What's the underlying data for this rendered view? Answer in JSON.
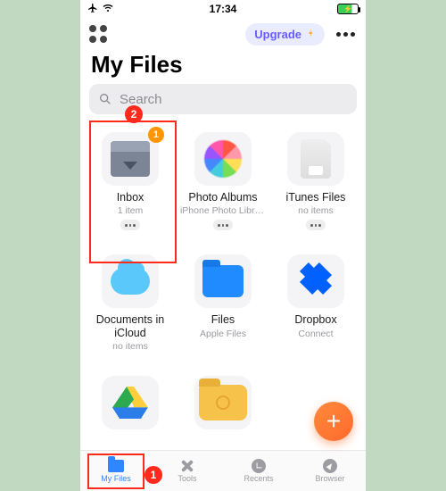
{
  "statusbar": {
    "time": "17:34"
  },
  "header": {
    "upgrade_label": "Upgrade",
    "title": "My Files"
  },
  "search": {
    "placeholder": "Search"
  },
  "tiles": [
    {
      "label": "Inbox",
      "sub": "1 item",
      "icon": "inbox",
      "badge": "1",
      "has_more": true
    },
    {
      "label": "Photo Albums",
      "sub": "iPhone Photo Libra...",
      "icon": "photos",
      "badge": null,
      "has_more": true
    },
    {
      "label": "iTunes Files",
      "sub": "no items",
      "icon": "itunes",
      "badge": null,
      "has_more": true
    },
    {
      "label": "Documents in iCloud",
      "sub": "no items",
      "icon": "icloud",
      "badge": null,
      "has_more": false
    },
    {
      "label": "Files",
      "sub": "Apple Files",
      "icon": "files",
      "badge": null,
      "has_more": false
    },
    {
      "label": "Dropbox",
      "sub": "Connect",
      "icon": "dropbox",
      "badge": null,
      "has_more": false
    },
    {
      "label": "",
      "sub": "",
      "icon": "gdrive",
      "badge": null,
      "has_more": false
    },
    {
      "label": "",
      "sub": "",
      "icon": "downloads",
      "badge": null,
      "has_more": false
    }
  ],
  "tabs": [
    {
      "label": "My Files",
      "icon": "folder",
      "active": true
    },
    {
      "label": "Tools",
      "icon": "tools",
      "active": false
    },
    {
      "label": "Recents",
      "icon": "clock",
      "active": false
    },
    {
      "label": "Browser",
      "icon": "compass",
      "active": false
    }
  ],
  "annotations": {
    "box_tile_index": 0,
    "step2_label": "2",
    "box_tab_index": 0,
    "step1_label": "1"
  }
}
